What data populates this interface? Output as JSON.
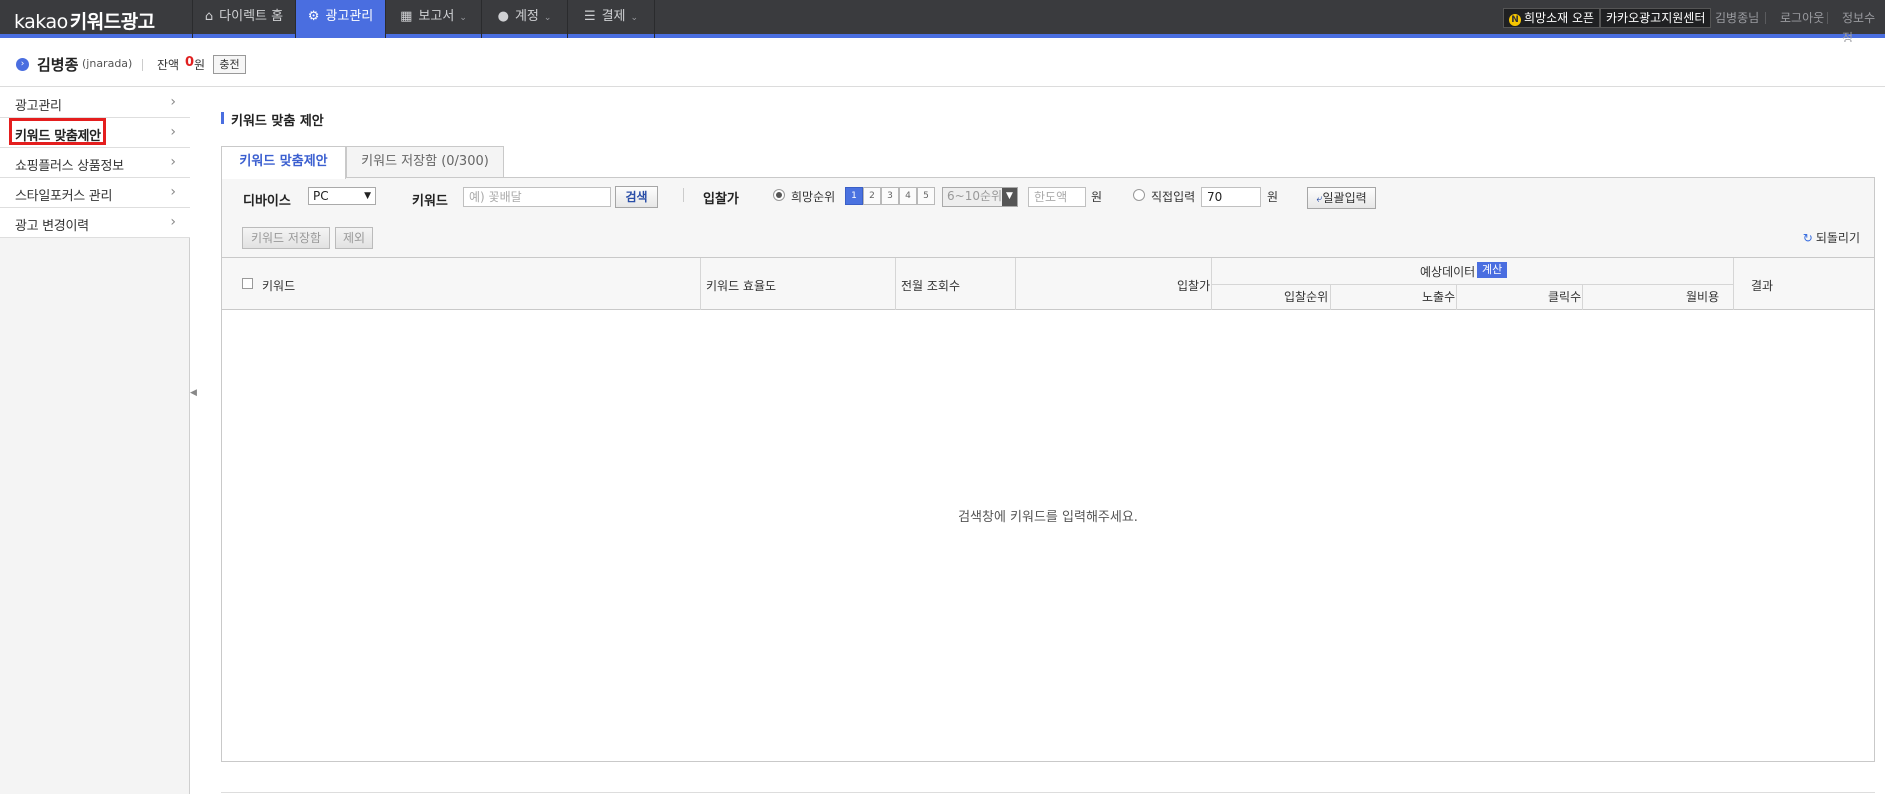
{
  "app": {
    "brand": "kakao",
    "product": "키워드광고"
  },
  "topnav": {
    "items": [
      {
        "label": "다이렉트 홈",
        "icon": "home-icon",
        "active": false,
        "dropdown": false
      },
      {
        "label": "광고관리",
        "icon": "gear-icon",
        "active": true,
        "dropdown": false
      },
      {
        "label": "보고서",
        "icon": "chart-icon",
        "active": false,
        "dropdown": true
      },
      {
        "label": "계정",
        "icon": "user-icon",
        "active": false,
        "dropdown": true
      },
      {
        "label": "결제",
        "icon": "database-icon",
        "active": false,
        "dropdown": true
      }
    ],
    "promo_badge": "N",
    "promo_label": "희망소재 오픈",
    "support_label": "카카오광고지원센터",
    "user_greeting": "김병종님",
    "logout_label": "로그아웃",
    "profile_label": "정보수정",
    "accent_color": "#4a6ee0"
  },
  "userbar": {
    "name": "김병종",
    "id": "(jnarada)",
    "balance_label": "잔액",
    "balance_value": "0",
    "balance_unit": "원",
    "charge_label": "충전"
  },
  "sidebar": {
    "items": [
      {
        "label": "광고관리"
      },
      {
        "label": "키워드 맞춤제안"
      },
      {
        "label": "쇼핑플러스 상품정보"
      },
      {
        "label": "스타일포커스 관리"
      },
      {
        "label": "광고 변경이력"
      }
    ],
    "highlight_color": "#e41e1e"
  },
  "main": {
    "title": "키워드 맞춤 제안",
    "tabs": [
      {
        "label": "키워드 맞춤제안",
        "active": true
      },
      {
        "label": "키워드 저장함 (0/300)",
        "active": false
      }
    ],
    "filters": {
      "device_label": "디바이스",
      "device_value": "PC",
      "keyword_label": "키워드",
      "keyword_placeholder": "예) 꽃배달",
      "search_label": "검색",
      "bid_label": "입찰가",
      "rank_option_label": "희망순위",
      "ranks": [
        "1",
        "2",
        "3",
        "4",
        "5"
      ],
      "rank_range_value": "6~10순위",
      "limit_placeholder": "한도액",
      "won": "원",
      "direct_label": "직접입력",
      "direct_value": "70",
      "bulk_label": "일괄입력"
    },
    "actions": {
      "save_label": "키워드 저장함",
      "exclude_label": "제외",
      "refresh_label": "되돌리기"
    },
    "table": {
      "columns": {
        "keyword": "키워드",
        "efficiency": "키워드 효율도",
        "monthly": "전월 조회수",
        "bid": "입찰가",
        "estimate": "예상데이터",
        "calc": "계산",
        "rank": "입찰순위",
        "impressions": "노출수",
        "clicks": "클릭수",
        "monthly_cost": "월비용",
        "result": "결과"
      },
      "empty_message": "검색창에 키워드를 입력해주세요."
    }
  }
}
